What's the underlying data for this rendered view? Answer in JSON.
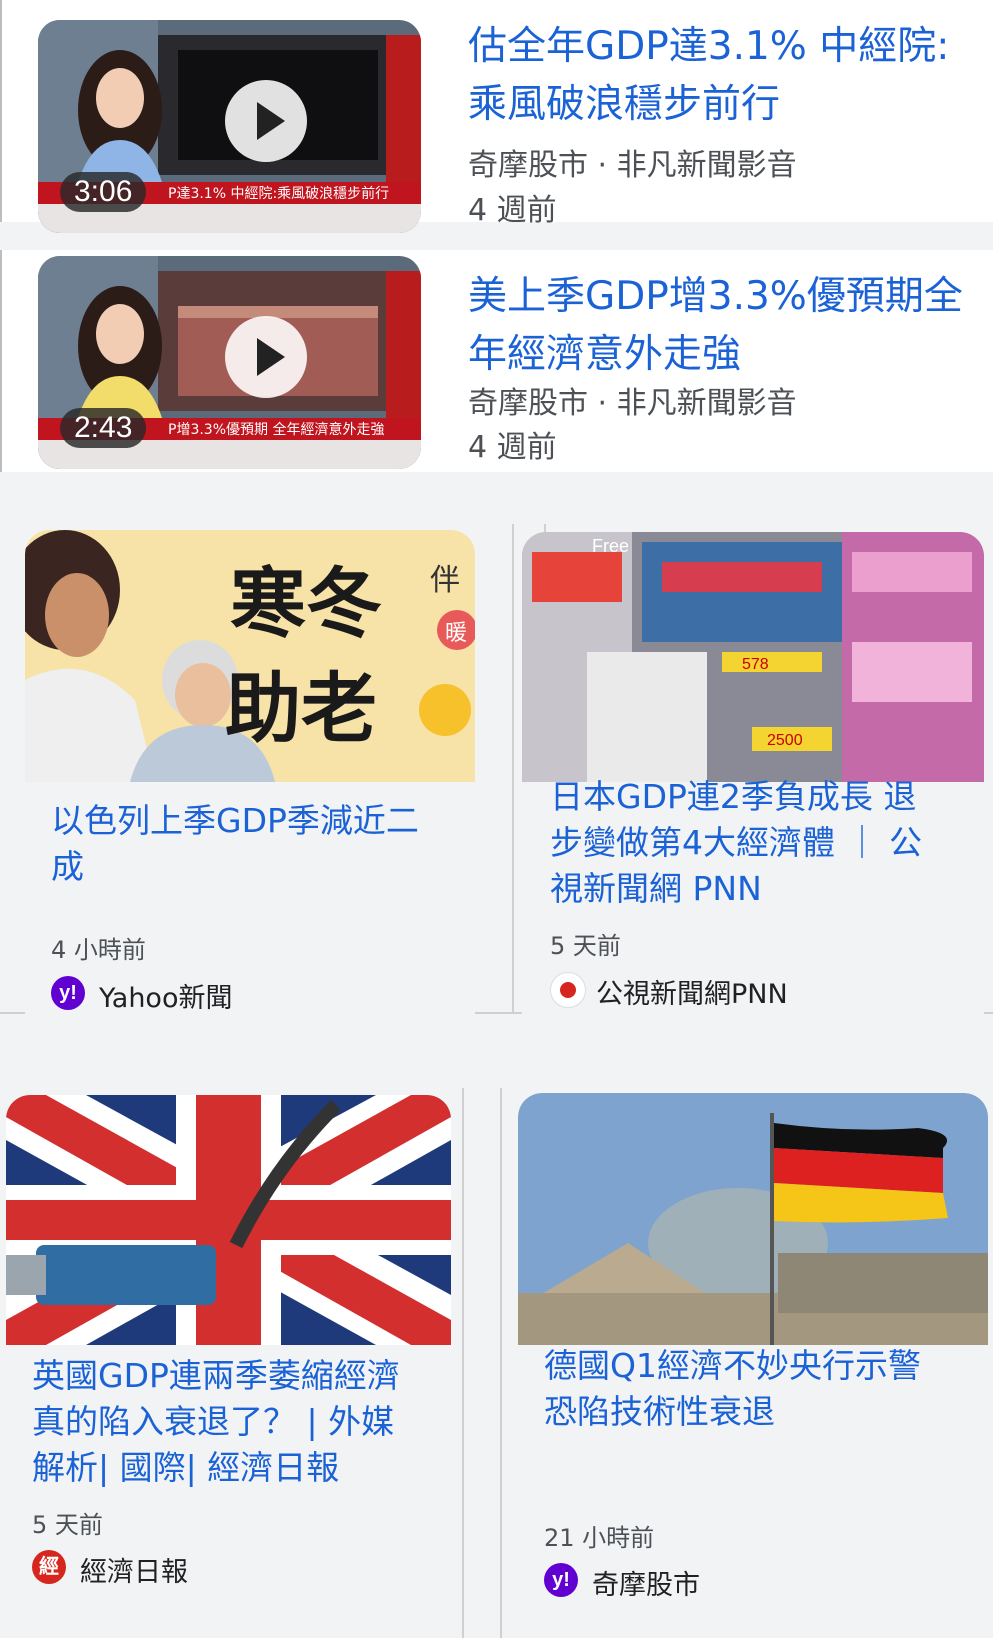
{
  "videos": [
    {
      "title": "估全年GDP達3.1% 中經院:乘風破浪穩步前行",
      "duration": "3:06",
      "source": "奇摩股市 · 非凡新聞影音",
      "time": "4 週前",
      "thumb_ticker": "P達3.1% 中經院:乘風破浪穩步前行"
    },
    {
      "title": "美上季GDP增3.3%優預期全年經濟意外走強",
      "duration": "2:43",
      "source": "奇摩股市 · 非凡新聞影音",
      "time": "4 週前",
      "thumb_ticker": "P增3.3%優預期 全年經濟意外走強"
    }
  ],
  "cards": [
    {
      "title": "以色列上季GDP季減近二成",
      "time": "4 小時前",
      "source": "Yahoo新聞",
      "logo": "y!",
      "image_text": {
        "line1": "寒冬",
        "line2": "助老",
        "side": "伴",
        "side2": "暖"
      }
    },
    {
      "title": "日本GDP連2季負成長 退步變做第4大經濟體 ｜ 公視新聞網 PNN",
      "time": "5 天前",
      "source": "公視新聞網PNN",
      "logo": "PNN",
      "image_text": {
        "free": "Free",
        "price1": "578",
        "price2": "2500"
      }
    },
    {
      "title": "英國GDP連兩季萎縮經濟真的陷入衰退了？ | 外媒解析| 國際| 經濟日報",
      "time": "5 天前",
      "source": "經濟日報",
      "logo": "經"
    },
    {
      "title": "德國Q1經濟不妙央行示警恐陷技術性衰退",
      "time": "21 小時前",
      "source": "奇摩股市",
      "logo": "y!"
    }
  ],
  "colors": {
    "title": "#1a62d6",
    "yahoo": "#6001d2",
    "udn": "#d7261e"
  }
}
